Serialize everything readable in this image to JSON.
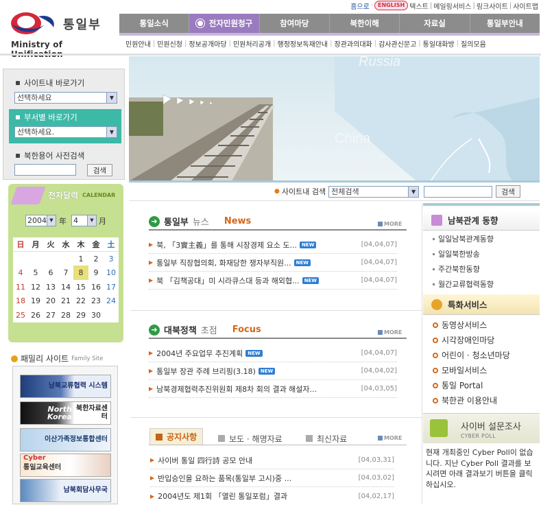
{
  "header": {
    "logo_kor": "통일부",
    "logo_eng": "Ministry of Unification",
    "toplinks": {
      "home": "홈으로",
      "english": "ENGLISH",
      "text": "텍스트",
      "mailing": "메일링서비스",
      "link": "링크사이트",
      "sitemap": "사이트맵"
    },
    "gnb": [
      "통일소식",
      "전자민원청구",
      "참여마당",
      "북한이해",
      "자료실",
      "통일부안내"
    ],
    "gnb_active": 1,
    "subnav": [
      "민원안내",
      "민원신청",
      "정보공개마당",
      "민원처리공개",
      "행정정보독재안내",
      "장관과의대화",
      "감사관신문고",
      "통일대화방",
      "질의모음"
    ]
  },
  "left": {
    "site_nav_label": "사이트내 바로가기",
    "site_nav_value": "선택하세요",
    "dept_nav_label": "부서별 바로가기",
    "dept_nav_value": "선택하세요.",
    "dict_label": "북한용어 사전검색",
    "dict_button": "검색",
    "calendar": {
      "title": "전자달력",
      "title_en": "CALENDAR",
      "year": "2004",
      "year_suffix": "年",
      "month": "4",
      "month_suffix": "月",
      "weekdays": [
        "日",
        "月",
        "火",
        "水",
        "木",
        "金",
        "土"
      ],
      "weeks": [
        [
          "",
          "",
          "",
          "",
          "1",
          "2",
          "3"
        ],
        [
          "4",
          "5",
          "6",
          "7",
          "8",
          "9",
          "10"
        ],
        [
          "11",
          "12",
          "13",
          "14",
          "15",
          "16",
          "17"
        ],
        [
          "18",
          "19",
          "20",
          "21",
          "22",
          "23",
          "24"
        ],
        [
          "25",
          "26",
          "27",
          "28",
          "29",
          "30",
          ""
        ]
      ],
      "today": "8"
    },
    "family_title": "패밀리 사이트",
    "family_title_en": "Family Site",
    "family_sites": [
      "남북교류협력 시스템",
      "북한자료센터",
      "이산가족정보통합센터",
      "통일교육센터",
      "남북회담사무국"
    ],
    "family_banner_extra": [
      "North Korea",
      "Cyber"
    ]
  },
  "hero": {
    "label_russia": "Russia",
    "label_china": "China"
  },
  "search": {
    "label": "사이트내 검색",
    "scope": "전체검색",
    "button": "검색"
  },
  "news": {
    "title": "통일부",
    "title_gray": "뉴스",
    "title_en": "News",
    "more": "MORE",
    "items": [
      {
        "text": "북, 「3實主義」를 통해 시장경제 요소 도...",
        "new": true,
        "date": "[04,04,07]"
      },
      {
        "text": "통일부 직장협의회, 화재당한 쟁자부직원...",
        "new": true,
        "date": "[04,04,07]"
      },
      {
        "text": "북 「김책공대」미 시라큐스대 등과 해외협...",
        "new": true,
        "date": "[04,04,07]"
      }
    ],
    "new_label": "NEW"
  },
  "policy": {
    "title": "대북정책",
    "title_gray": "초점",
    "title_en": "Focus",
    "more": "MORE",
    "items": [
      {
        "text": "2004년 주요업무 추진계획",
        "new": true,
        "date": "[04,04,07]"
      },
      {
        "text": "통일부 장관 주례 브리핑(3.18)",
        "new": true,
        "date": "[04,04,02]"
      },
      {
        "text": "남북경제협력추진위원회 제8차 회의 결과 해설자...",
        "new": false,
        "date": "[04,03,05]"
      }
    ]
  },
  "notice": {
    "tabs": [
      "공지사항",
      "보도 · 해명자료",
      "최신자료"
    ],
    "more": "MORE",
    "items": [
      {
        "text": "사이버 통일 四行詩 공모 안내",
        "date": "[04,03,31]"
      },
      {
        "text": "반입승인을 요하는 품목(통일부 고시)중 ...",
        "date": "[04,03,02]"
      },
      {
        "text": "2004년도 제1회 「열린 통일포럼」결과",
        "date": "[04,02,17]"
      }
    ]
  },
  "right": {
    "trend_title": "남북관계 동향",
    "trend_items": [
      "일일남북관계동향",
      "일일북한방송",
      "주간북한동향",
      "월간교류협력동향"
    ],
    "special_title": "특화서비스",
    "special_items": [
      "동영상서비스",
      "시각장애인마당",
      "어린이 · 청소년마당",
      "모바일서비스",
      "통일 Portal",
      "북한관 이용안내"
    ],
    "poll_title": "사이버 설문조사",
    "poll_en": "CYBER POLL",
    "poll_text": "현재 개최중인 Cyber Poll이 없습니다. 지난 Cyber Poll 결과를 보시려면 아래 결과보기 버튼을 클릭하십시오."
  }
}
